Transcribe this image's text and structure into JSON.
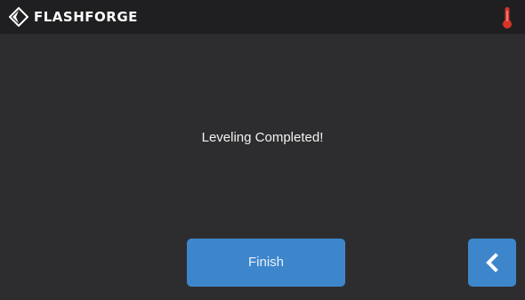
{
  "header": {
    "brand": "FLASHFORGE",
    "logo_icon": "flashforge-logo-icon",
    "status_icon": "thermometer-icon",
    "status_icon_color": "#d9342b"
  },
  "main": {
    "message": "Leveling Completed!"
  },
  "footer": {
    "finish_label": "Finish",
    "back_icon": "chevron-left-icon"
  },
  "colors": {
    "background": "#2d2d2f",
    "topbar": "#1f1f21",
    "accent": "#3e86cc"
  }
}
